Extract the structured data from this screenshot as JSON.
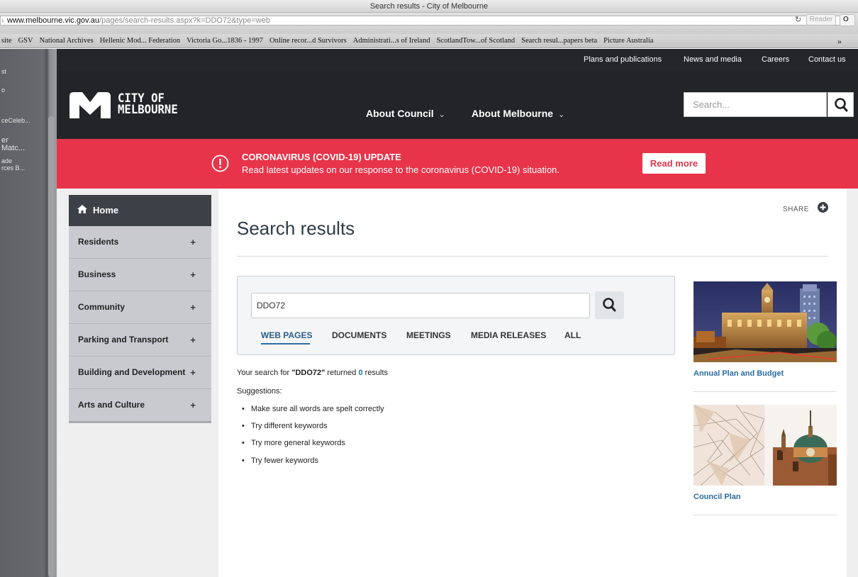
{
  "browser": {
    "window_title": "Search results - City of Melbourne",
    "url_host": "www.melbourne.vic.gov.au",
    "url_path": "/pages/search-results.aspx?k=DDO72&type=web",
    "reader_label": "Reader",
    "bookmarks": [
      "site",
      "GSV",
      "National Archives",
      "Hellenic Mod... Federation",
      "Victoria Go...1836 - 1997",
      "Online recor...d Survivors",
      "Administrati...s of Ireland",
      "ScotlandTow...of Scotland",
      "Search resul...papers beta",
      "Picture Australia"
    ],
    "bookmarks_more": "»"
  },
  "left_strip": {
    "items": [
      "st",
      "o",
      "ceCeleb...",
      "er",
      "Matc...",
      "ade",
      "rces B..."
    ]
  },
  "utility_nav": [
    "Plans and publications",
    "News and media",
    "Careers",
    "Contact us"
  ],
  "header": {
    "logo_line1": "CITY OF",
    "logo_line2": "MELBOURNE",
    "nav": [
      {
        "label": "About Council",
        "chevron": "⌄"
      },
      {
        "label": "About Melbourne",
        "chevron": "⌄"
      }
    ],
    "search_placeholder": "Search..."
  },
  "banner": {
    "title": "CORONAVIRUS (COVID-19) UPDATE",
    "text": "Read latest updates on our response to the coronavirus (COVID-19) situation.",
    "button": "Read more",
    "color": "#e8344a"
  },
  "sidebar": {
    "home": "Home",
    "items": [
      {
        "label": "Residents",
        "toggle": "+"
      },
      {
        "label": "Business",
        "toggle": "+"
      },
      {
        "label": "Community",
        "toggle": "+"
      },
      {
        "label": "Parking and Transport",
        "toggle": "+"
      },
      {
        "label": "Building and Development",
        "toggle": "+"
      },
      {
        "label": "Arts and Culture",
        "toggle": "+"
      }
    ]
  },
  "main": {
    "share_label": "SHARE",
    "title": "Search results",
    "search_value": "DDO72",
    "tabs": [
      "WEB PAGES",
      "DOCUMENTS",
      "MEETINGS",
      "MEDIA RELEASES",
      "ALL"
    ],
    "active_tab": "WEB PAGES",
    "result_prefix": "Your search for ",
    "result_query": "\"DDO72\"",
    "result_mid": " returned ",
    "result_count": "0",
    "result_suffix": " results",
    "suggestions_label": "Suggestions:",
    "suggestions": [
      "Make sure all words are spelt correctly",
      "Try different keywords",
      "Try more general keywords",
      "Try fewer keywords"
    ]
  },
  "promos": [
    {
      "label": "Annual Plan and Budget"
    },
    {
      "label": "Council Plan"
    }
  ]
}
